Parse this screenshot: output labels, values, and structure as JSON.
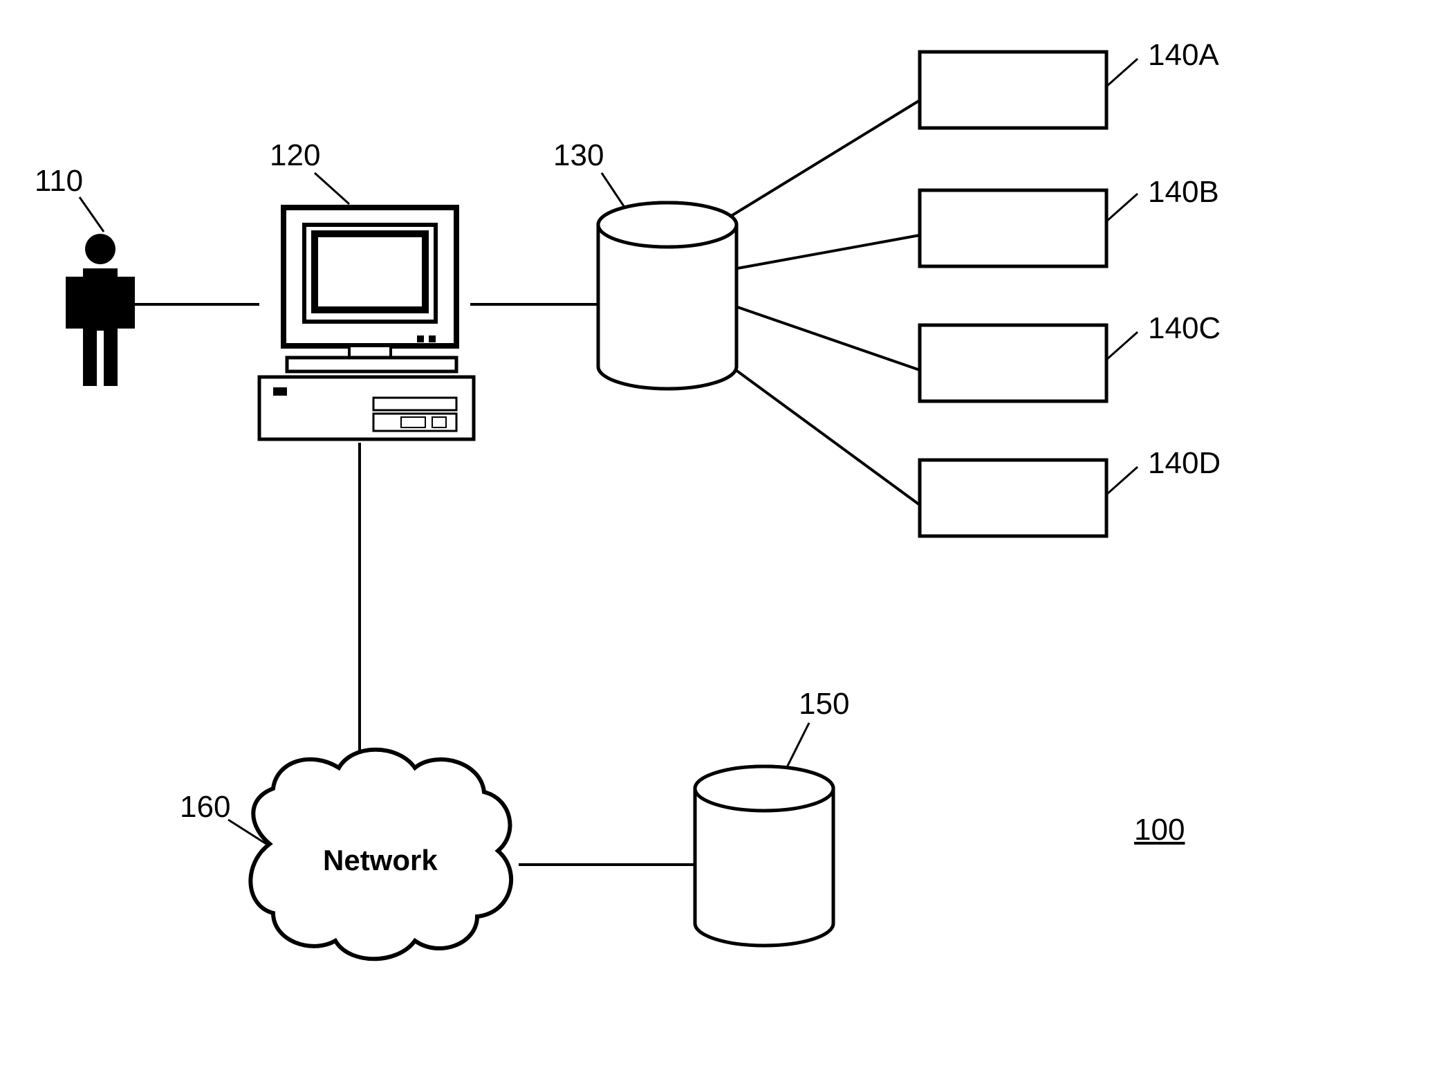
{
  "labels": {
    "user": "110",
    "computer": "120",
    "database1": "130",
    "box_a": "140A",
    "box_b": "140B",
    "box_c": "140C",
    "box_d": "140D",
    "database2": "150",
    "network": "160",
    "network_text": "Network",
    "figure": "100"
  },
  "diagram": {
    "type": "network_architecture",
    "nodes": [
      {
        "id": "110",
        "type": "user",
        "description": "person/user icon"
      },
      {
        "id": "120",
        "type": "computer",
        "description": "desktop computer with monitor"
      },
      {
        "id": "130",
        "type": "database",
        "description": "cylinder database"
      },
      {
        "id": "140A",
        "type": "box",
        "description": "rectangle box"
      },
      {
        "id": "140B",
        "type": "box",
        "description": "rectangle box"
      },
      {
        "id": "140C",
        "type": "box",
        "description": "rectangle box"
      },
      {
        "id": "140D",
        "type": "box",
        "description": "rectangle box"
      },
      {
        "id": "150",
        "type": "database",
        "description": "cylinder database"
      },
      {
        "id": "160",
        "type": "network",
        "description": "network cloud"
      }
    ],
    "connections": [
      {
        "from": "110",
        "to": "120"
      },
      {
        "from": "120",
        "to": "130"
      },
      {
        "from": "130",
        "to": "140A"
      },
      {
        "from": "130",
        "to": "140B"
      },
      {
        "from": "130",
        "to": "140C"
      },
      {
        "from": "130",
        "to": "140D"
      },
      {
        "from": "120",
        "to": "160"
      },
      {
        "from": "160",
        "to": "150"
      }
    ]
  }
}
